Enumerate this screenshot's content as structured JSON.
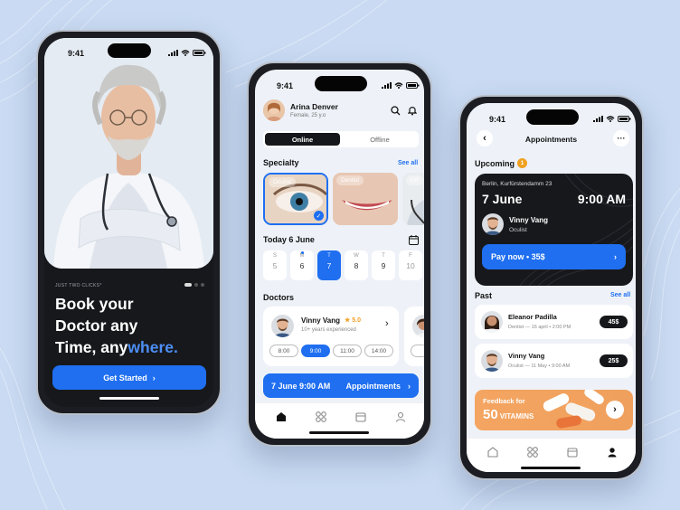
{
  "colors": {
    "accent": "#1f6ff0",
    "dark": "#17181c",
    "star": "#f0a020",
    "badge": "#f0a020",
    "promo": "#f4a561"
  },
  "onboarding": {
    "status_time": "9:41",
    "tagline": "JUST TWO CLICKS*",
    "headline_1": "Book your",
    "headline_2": "Doctor any",
    "headline_3a": "Time, any",
    "headline_3b": "where.",
    "cta": "Get Started"
  },
  "home": {
    "status_time": "9:41",
    "user_name": "Arina Denver",
    "user_meta": "Female, 25 y.o",
    "tabs": [
      "Online",
      "Offline"
    ],
    "specialty_title": "Specialty",
    "see_all": "See all",
    "specialties": [
      "Oculist",
      "Dentist",
      "GP"
    ],
    "today": "Today 6 June",
    "days": [
      {
        "d": "S",
        "n": "5"
      },
      {
        "d": "M",
        "n": "6"
      },
      {
        "d": "T",
        "n": "7"
      },
      {
        "d": "W",
        "n": "8"
      },
      {
        "d": "T",
        "n": "9"
      },
      {
        "d": "F",
        "n": "10"
      }
    ],
    "doctors_title": "Doctors",
    "doctor": {
      "name": "Vinny Vang",
      "rating": "5.0",
      "experience": "10+ years experienced"
    },
    "times": [
      "8:00",
      "9:00",
      "11:00",
      "14:00"
    ],
    "appointment_bar": {
      "date": "7 June 9:00 AM",
      "label": "Appointments"
    },
    "nav_icons": [
      "home-icon",
      "grid-icon",
      "calendar-icon",
      "profile-icon"
    ]
  },
  "appointments": {
    "status_time": "9:41",
    "title": "Appointments",
    "upcoming_title": "Upcoming",
    "upcoming_count": "1",
    "upcoming": {
      "address": "Berlin, Kurfürstendamm 23",
      "date": "7 June",
      "time": "9:00 AM",
      "doctor": "Vinny Vang",
      "specialty": "Oculist",
      "pay": "Pay now • 35$"
    },
    "past_title": "Past",
    "see_all": "See all",
    "past": [
      {
        "name": "Eleanor Padilla",
        "meta": "Dentist — 16 april • 2:00 PM",
        "price": "45$"
      },
      {
        "name": "Vinny Vang",
        "meta": "Oculist — 11 May • 9:00 AM",
        "price": "25$"
      }
    ],
    "promo": {
      "line1": "Feedback for",
      "number": "50",
      "word": "VITAMINS"
    },
    "nav_icons": [
      "home-icon",
      "grid-icon",
      "calendar-icon",
      "profile-icon"
    ]
  }
}
